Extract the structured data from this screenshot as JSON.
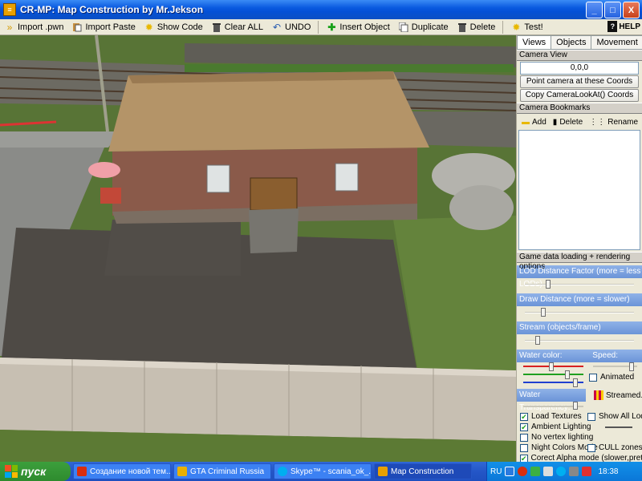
{
  "window": {
    "title": "CR-MP: Map Construction by Mr.Jekson",
    "icon_label": "≡",
    "controls": {
      "minimize": "_",
      "maximize": "□",
      "close": "X"
    }
  },
  "toolbar": {
    "items": [
      {
        "label": "Import .pwn",
        "icon": "arrow-icon"
      },
      {
        "label": "Import Paste",
        "icon": "paste-icon"
      },
      {
        "label": "Show Code",
        "icon": "sun-icon"
      },
      {
        "label": "Clear ALL",
        "icon": "trash-icon"
      },
      {
        "label": "UNDO",
        "icon": "undo-icon"
      },
      {
        "label": "Insert Object",
        "icon": "plus-icon"
      },
      {
        "label": "Duplicate",
        "icon": "copy-icon"
      },
      {
        "label": "Delete",
        "icon": "trash-icon"
      },
      {
        "label": "Test!",
        "icon": "sun-icon"
      }
    ],
    "help_label": "HELP"
  },
  "panel": {
    "tabs": [
      {
        "label": "Views",
        "active": true
      },
      {
        "label": "Objects",
        "active": false
      },
      {
        "label": "Movement",
        "active": false
      }
    ],
    "camera_view": {
      "heading": "Camera View",
      "coords": "0,0,0",
      "point_button": "Point camera at these Coords",
      "copy_button": "Copy CameraLookAt() Coords"
    },
    "bookmarks": {
      "heading": "Camera Bookmarks",
      "add_label": "Add",
      "delete_label": "Delete",
      "rename_label": "Rename"
    },
    "game_options": {
      "heading": "Game data loading + rendering options",
      "lod_label": "LOD Distance Factor (more = less LODs)",
      "lod_value": 0.2,
      "draw_label": "Draw Distance (more = slower)",
      "draw_value": 0.15,
      "stream_label": "Stream (objects/frame)",
      "stream_value": 0.1,
      "water_color_label": "Water color:",
      "speed_label": "Speed:",
      "animated_label": "Animated",
      "water_transparency_label": "Water Transparency:",
      "streamed_label": "Streamed..",
      "checks": [
        {
          "label": "Load Textures",
          "checked": true,
          "right_label": "Show All Lods",
          "right_checked": false
        },
        {
          "label": "Ambient Lighting",
          "checked": true
        },
        {
          "label": "No vertex lighting",
          "checked": false
        },
        {
          "label": "Night Colors Mode",
          "checked": false,
          "right_label": "CULL zones",
          "right_checked": false
        },
        {
          "label": "Corect Alpha mode (slower,prettier)",
          "checked": true
        }
      ]
    }
  },
  "taskbar": {
    "start_label": "пуск",
    "tasks": [
      {
        "label": "Создание новой тем...",
        "color": "#d82e0e"
      },
      {
        "label": "GTA Criminal Russia",
        "color": "#e8b000"
      },
      {
        "label": "Skype™ - scania_ok_...",
        "color": "#00aff0"
      },
      {
        "label": "Map Construction",
        "color": "#e8a000",
        "active": true
      }
    ],
    "lang": "RU",
    "clock": "18:38"
  },
  "colors": {
    "titlebar": "#0a5ae0",
    "panel_bg": "#ece9d8",
    "section_blue": "#7aa0df",
    "taskbar": "#2456c7"
  }
}
